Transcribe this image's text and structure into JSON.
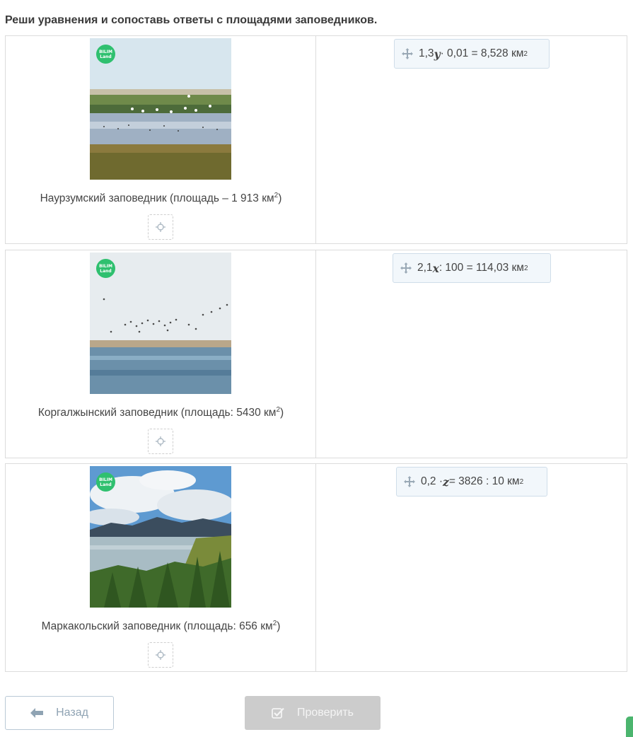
{
  "task": {
    "instruction": "Реши уравнения и сопоставь ответы с площадями заповедников."
  },
  "brand_badge": {
    "line1": "BILIM",
    "line2": "Land",
    "color": "#2fc06f"
  },
  "rows": [
    {
      "caption": "Наурзумский заповедник (площадь – 1 913 км",
      "caption_sup": "2",
      "caption_end": ")",
      "equation_pre": "1,3",
      "equation_var": "y",
      "equation_post": " · 0,01 = 8,528 км",
      "equation_sup": "2"
    },
    {
      "caption": "Коргалжынский заповедник (площадь: 5430 км",
      "caption_sup": "2",
      "caption_end": ")",
      "equation_pre": "2,1",
      "equation_var": "x",
      "equation_post": " : 100 = 114,03 км",
      "equation_sup": "2"
    },
    {
      "caption": "Маркакольский заповедник (площадь: 656 км",
      "caption_sup": "2",
      "caption_end": ")",
      "equation_pre": "0,2 · ",
      "equation_var": "z",
      "equation_post": " = 3826 : 10 км",
      "equation_sup": "2"
    }
  ],
  "buttons": {
    "back_label": "Назад",
    "back_icon": "arrow-left-icon",
    "check_label": "Проверить",
    "check_icon": "checkbox-check-icon"
  },
  "icons": {
    "move": "move-arrows-icon",
    "drop_target": "crosshair-icon"
  },
  "colors": {
    "chip_bg": "#f2f7fb",
    "chip_border": "#cfdde9",
    "check_disabled": "#cccccc",
    "back_text": "#8fa3b3",
    "accent_green": "#4bb56e"
  }
}
